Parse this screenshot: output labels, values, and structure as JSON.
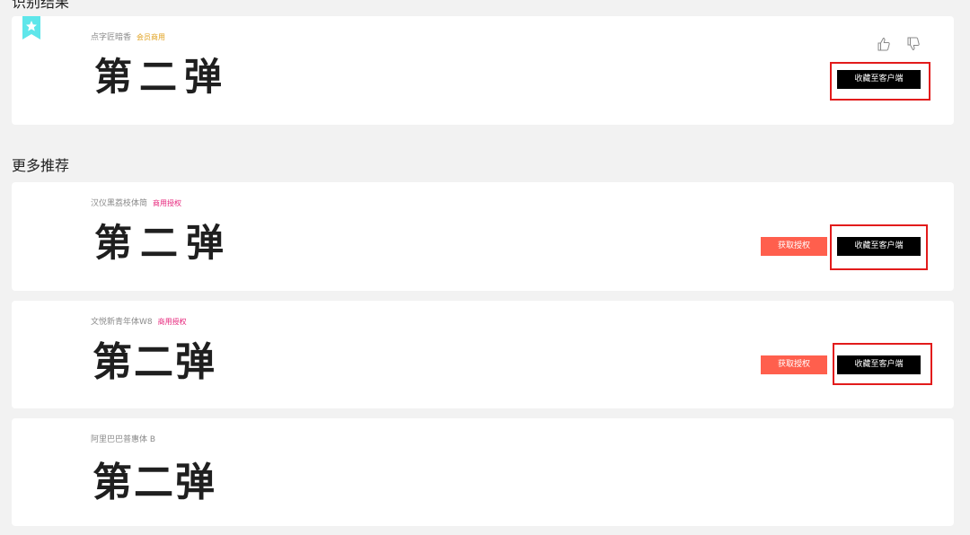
{
  "sections": {
    "top_title": "识别结果",
    "more_title": "更多推荐"
  },
  "result": {
    "font_name": "点字匠暗香",
    "badge": "会员商用",
    "preview": "第二弹",
    "save_label": "收藏至客户端"
  },
  "recommendations": [
    {
      "font_name": "汉仪黑荔枝体简",
      "badge": "商用授权",
      "preview": "第二弹",
      "license_label": "获取授权",
      "save_label": "收藏至客户端"
    },
    {
      "font_name": "文悦新青年体W8",
      "badge": "商用授权",
      "preview": "第二弹",
      "license_label": "获取授权",
      "save_label": "收藏至客户端"
    },
    {
      "font_name": "阿里巴巴普惠体 B",
      "preview": "第二弹"
    }
  ],
  "icons": {
    "bookmark": "bookmark-star-icon",
    "like": "thumbs-up-icon",
    "dislike": "thumbs-down-icon"
  },
  "colors": {
    "save_button": "#000000",
    "license_button": "#ff5f4d",
    "highlight_outline": "#e21b1b",
    "member_badge": "#e0a11f",
    "commercial_badge": "#e6237a",
    "bookmark": "#5ee6ea"
  }
}
